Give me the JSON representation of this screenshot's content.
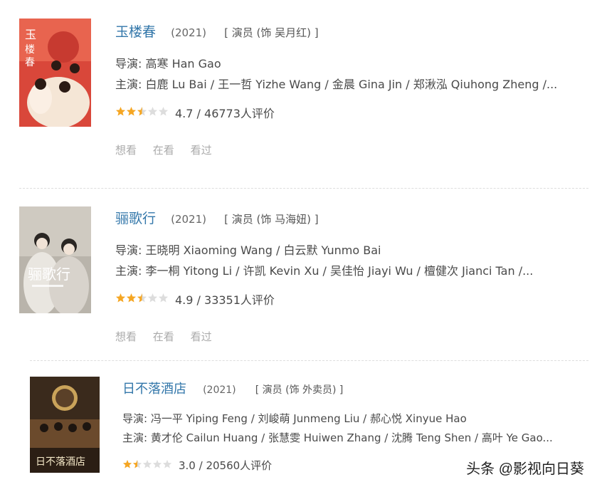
{
  "items": [
    {
      "title": "玉楼春",
      "year": "(2021)",
      "role": "[ 演员 (饰 吴月红) ]",
      "director_prefix": "导演: ",
      "director": "高寒 Han Gao",
      "cast_prefix": "主演: ",
      "cast": "白鹿 Lu Bai / 王一哲 Yizhe Wang / 金晨 Gina Jin / 郑湫泓 Qiuhong Zheng /...",
      "rating_text": "4.7 / 46773人评价",
      "stars": 2.5,
      "actions": [
        "想看",
        "在看",
        "看过"
      ],
      "poster_colors": {
        "bg": "#d9473a",
        "accent": "#f5e6d6"
      }
    },
    {
      "title": "骊歌行",
      "year": "(2021)",
      "role": "[ 演员 (饰 马海妞) ]",
      "director_prefix": "导演: ",
      "director": "王晓明 Xiaoming Wang / 白云默 Yunmo Bai",
      "cast_prefix": "主演: ",
      "cast": "李一桐 Yitong Li / 许凯 Kevin Xu / 吴佳怡 Jiayi Wu / 檀健次 Jianci Tan /...",
      "rating_text": "4.9 / 33351人评价",
      "stars": 2.5,
      "actions": [
        "想看",
        "在看",
        "看过"
      ],
      "poster_colors": {
        "bg": "#b9b4ab",
        "accent": "#e9e6e0"
      }
    },
    {
      "title": "日不落酒店",
      "year": "(2021)",
      "role": "[ 演员 (饰 外卖员) ]",
      "director_prefix": "导演: ",
      "director": "冯一平 Yiping Feng / 刘峻萌 Junmeng Liu / 郝心悦 Xinyue Hao",
      "cast_prefix": "主演: ",
      "cast": "黄才伦 Cailun Huang / 张慧雯 Huiwen Zhang / 沈腾 Teng Shen / 高叶 Ye Gao...",
      "rating_text": "3.0 / 20560人评价",
      "stars": 1.5,
      "actions": [],
      "poster_colors": {
        "bg": "#3a2a1c",
        "accent": "#c9a35a"
      }
    }
  ],
  "watermark": "头条 @影视向日葵",
  "colors": {
    "link": "#3377aa",
    "star": "#f5a623",
    "star_empty": "#dddddd"
  }
}
